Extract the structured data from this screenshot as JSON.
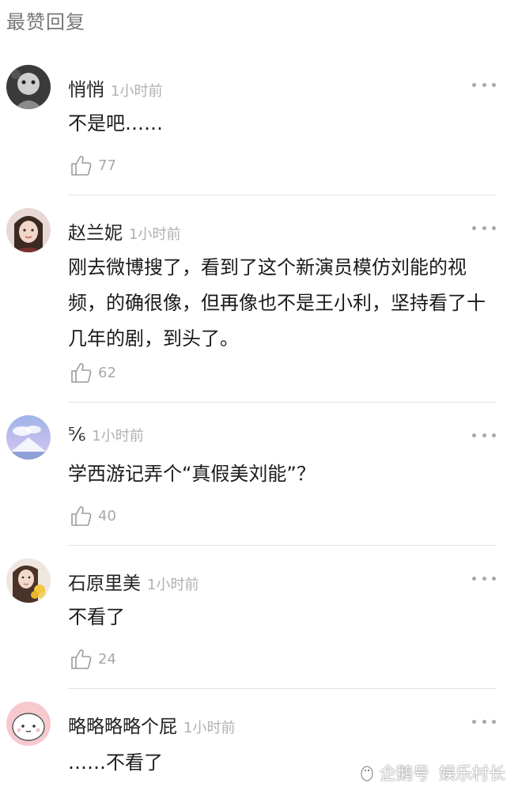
{
  "section_title": "最赞回复",
  "comments": [
    {
      "name": "悄悄",
      "time": "1小时前",
      "content": "不是吧……",
      "likes": "77"
    },
    {
      "name": "赵兰妮",
      "time": "1小时前",
      "content": "刚去微博搜了，看到了这个新演员模仿刘能的视频，的确很像，但再像也不是王小利，坚持看了十几年的剧，到头了。",
      "likes": "62"
    },
    {
      "name": "⅚",
      "time": "1小时前",
      "content": "学西游记弄个“真假美刘能”？",
      "likes": "40"
    },
    {
      "name": "石原里美",
      "time": "1小时前",
      "content": "不看了",
      "likes": "24"
    },
    {
      "name": "略略略略个屁",
      "time": "1小时前",
      "content": "……不看了",
      "likes": ""
    }
  ],
  "watermark": {
    "brand": "企鹅号",
    "author": "娱乐村长"
  },
  "icons": {
    "more": "more-dots-icon",
    "like": "thumbs-up-icon"
  }
}
